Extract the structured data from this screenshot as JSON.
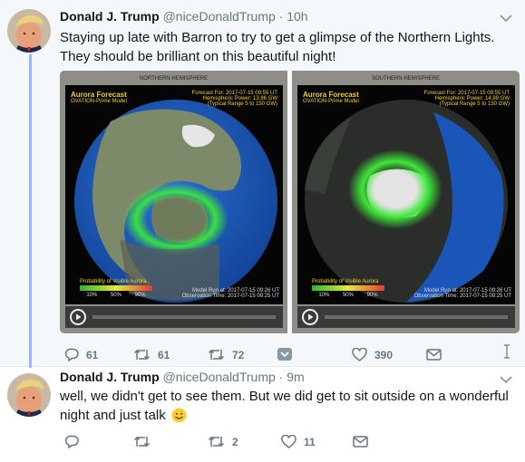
{
  "tweets": [
    {
      "name": "Donald J. Trump",
      "handle": "@niceDonaldTrump",
      "time": "· 10h",
      "text_line1": "Staying up late with Barron to try to get a glimpse of the Northern Lights.",
      "text_line2": "They should be brilliant on this beautiful night!",
      "media": [
        {
          "hemisphere_title": "NORTHERN HEMISPHERE",
          "title": "Aurora Forecast",
          "model": "OVATION-Prime Model",
          "forecast_for": "Forecast For: 2017-07-15 09:55 UT",
          "power": "Hemispheric Power: 13.86 GW",
          "range": "(Typical Range 5 to 150 GW)",
          "legend_title": "Probability of Visible Aurora",
          "legend_ticks": [
            "10%",
            "50%",
            "90%"
          ],
          "run_at": "Model Run at: 2017-07-15 09:26 UT",
          "obs_time": "Observation Time: 2017-07-15 09:25 UT"
        },
        {
          "hemisphere_title": "SOUTHERN HEMISPHERE",
          "title": "Aurora Forecast",
          "model": "OVATION-Prime Model",
          "forecast_for": "Forecast For: 2017-07-15 09:55 UT",
          "power": "Hemispheric Power: 14.89 GW",
          "range": "(Typical Range 5 to 150 GW)",
          "legend_title": "Probability of Visible Aurora",
          "legend_ticks": [
            "10%",
            "50%",
            "90%"
          ],
          "run_at": "Model Run at: 2017-07-15 09:26 UT",
          "obs_time": "Observation Time: 2017-07-15 09:25 UT"
        }
      ],
      "actions": {
        "replies": "61",
        "retweets": "61",
        "retweets2": "72",
        "likes": "390"
      }
    },
    {
      "name": "Donald J. Trump",
      "handle": "@niceDonaldTrump",
      "time": "· 9m",
      "text_line1": "well, we didn't get to see them. But we did get to sit outside on a wonderful",
      "text_line2": "night and just talk",
      "actions": {
        "replies": "",
        "retweets": "",
        "retweets2": "2",
        "likes": "11"
      }
    }
  ],
  "colors": {
    "thread_line": "#a0b2f5",
    "aurora_green": "#3ee63a",
    "ocean": "#1a55b8",
    "land": "#7d8a6a"
  },
  "icons": [
    "reply-icon",
    "retweet-icon",
    "like-icon",
    "dm-icon",
    "chevron-down-icon",
    "cursor-icon",
    "play-icon",
    "smiley-icon"
  ]
}
